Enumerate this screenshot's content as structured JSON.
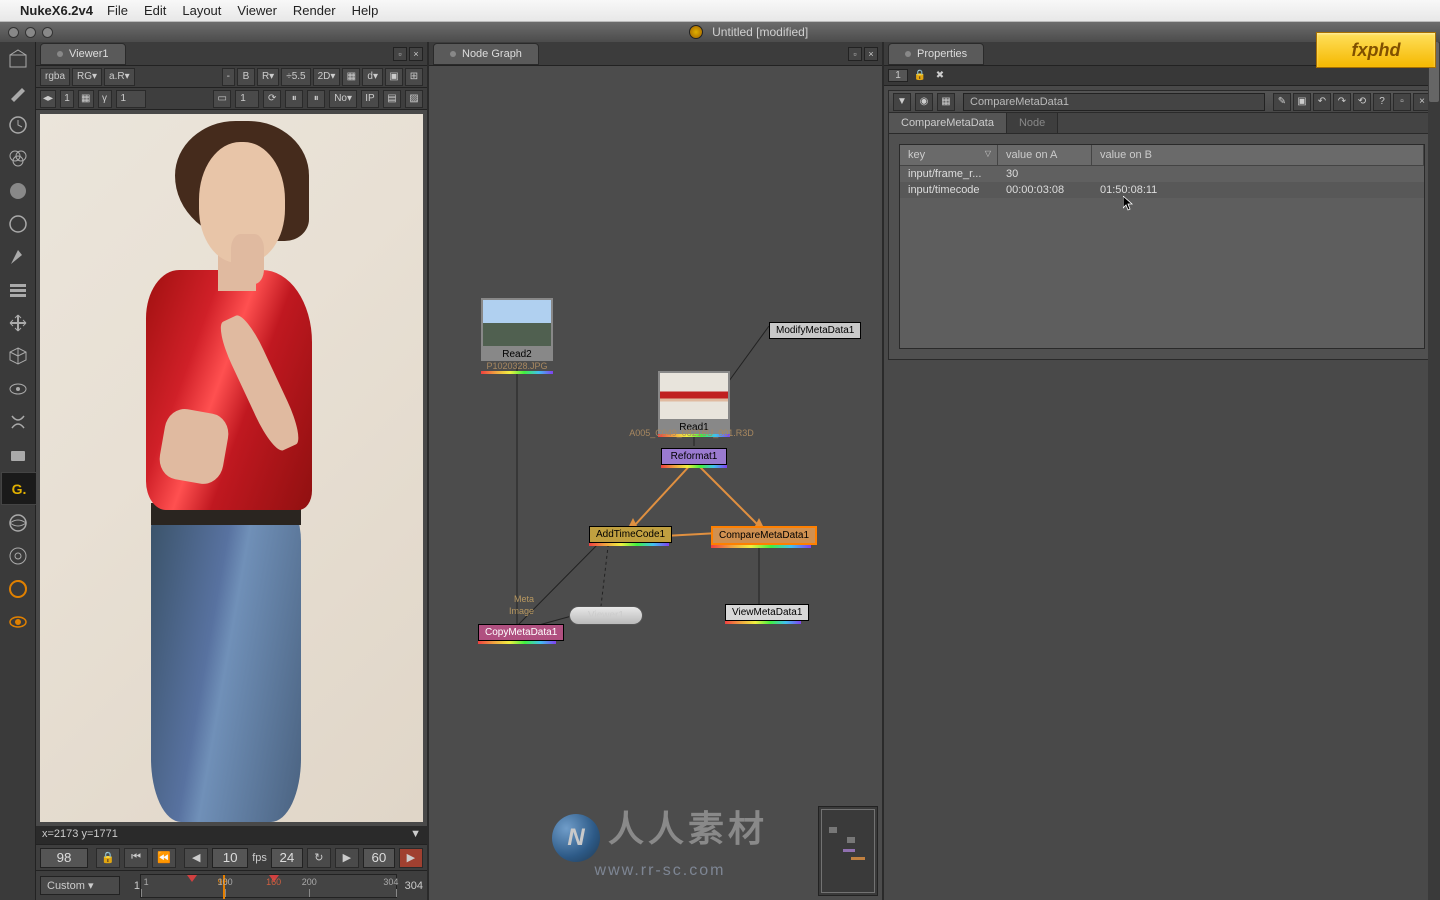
{
  "menubar": {
    "app": "NukeX6.2v4",
    "items": [
      "File",
      "Edit",
      "Layout",
      "Viewer",
      "Render",
      "Help"
    ]
  },
  "window": {
    "title": "Untitled [modified]"
  },
  "logo": "fxphd",
  "panels": {
    "viewer_tab": "Viewer1",
    "nodegraph_tab": "Node Graph",
    "properties_tab": "Properties"
  },
  "viewer_toolbar": {
    "channel": "rgba",
    "r": "RG▾",
    "a": "a.R▾",
    "dash": "-",
    "b_label": "B",
    "r2": "R▾",
    "zoom": "÷5.5",
    "dim": "2D▾",
    "d": "d▾"
  },
  "viewer_toolbar2": {
    "frame_small": "1",
    "gamma_btn": "γ",
    "gamma_val": "1",
    "one": "1",
    "no": "No▾",
    "ip": "IP"
  },
  "viewer_status": {
    "text": "x=2173 y=1771"
  },
  "timeline": {
    "frame": "98",
    "fps_label": "fps",
    "fps_value": "24",
    "step": "10",
    "inc": "60"
  },
  "ruler": {
    "mode": "Custom",
    "ticks": [
      "1",
      "100",
      "200",
      "304"
    ],
    "current": "98",
    "curr_alt": "98",
    "marker2": "160",
    "min": "1",
    "max": "304"
  },
  "nodes": {
    "read2": {
      "label": "Read2",
      "file": "P1020328.JPG"
    },
    "read1": {
      "label": "Read1",
      "file": "A005_C049_08216U_001.R3D"
    },
    "reformat": "Reformat1",
    "addtimecode": "AddTimeCode1",
    "comparemeta": "CompareMetaData1",
    "viewer": "Viewer1",
    "viewmeta": "ViewMetaData1",
    "modifymeta": "ModifyMetaData1",
    "copymeta": "CopyMetaData1",
    "ann_meta": "Meta",
    "ann_image": "Image"
  },
  "properties": {
    "count": "1",
    "node_name": "CompareMetaData1",
    "tabs": [
      "CompareMetaData",
      "Node"
    ],
    "table": {
      "headers": {
        "key": "key",
        "a": "value on A",
        "b": "value on B"
      },
      "rows": [
        {
          "key": "input/frame_r...",
          "a": "30",
          "b": ""
        },
        {
          "key": "input/timecode",
          "a": "00:00:03:08",
          "b": "01:50:08:11"
        }
      ]
    }
  },
  "watermark": {
    "cn": "人人素材",
    "url": "www.rr-sc.com"
  }
}
